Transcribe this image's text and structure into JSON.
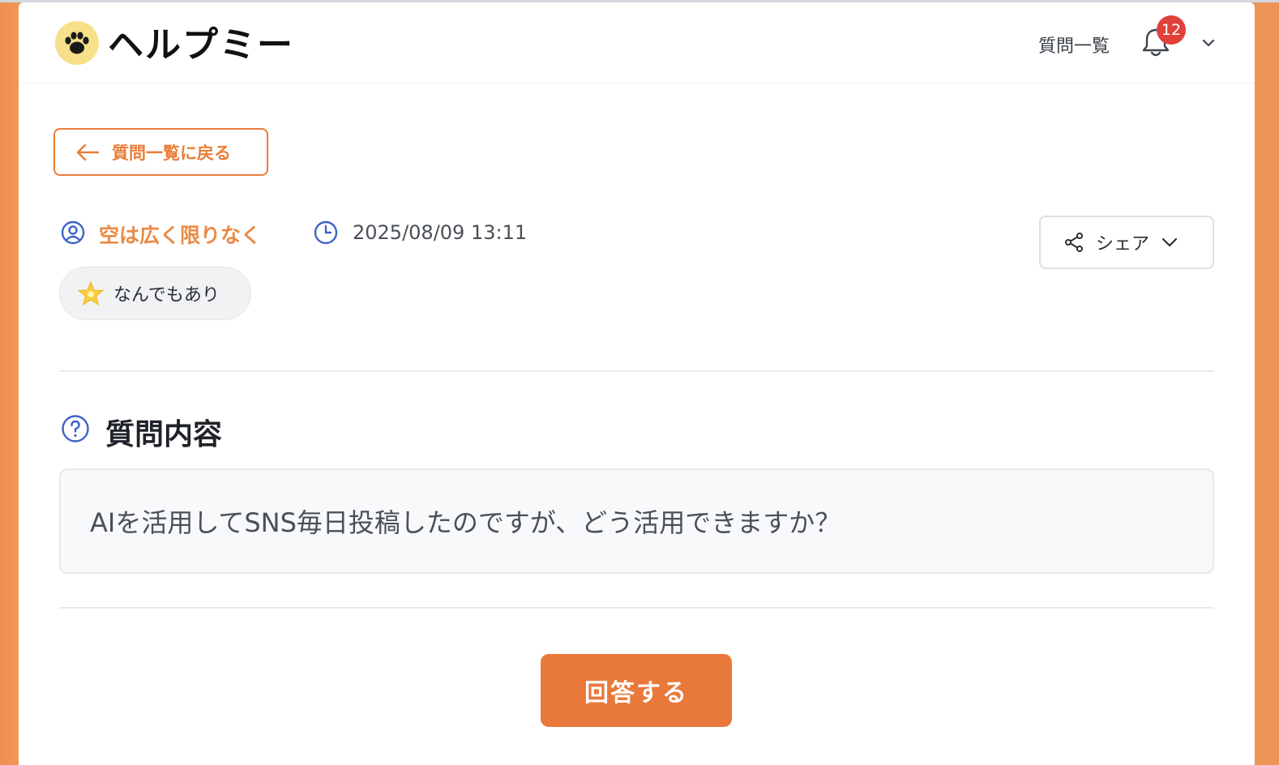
{
  "header": {
    "logo_text": "ヘルプミー",
    "nav_questions": "質問一覧",
    "notification_count": "12"
  },
  "back_button": {
    "label": "質問一覧に戻る"
  },
  "question_meta": {
    "author": "空は広く限りなく",
    "datetime": "2025/08/09 13:11"
  },
  "share": {
    "label": "シェア"
  },
  "tag": {
    "label": "なんでもあり"
  },
  "question_section": {
    "title": "質問内容",
    "body": "AIを活用してSNS毎日投稿したのですが、どう活用できますか？"
  },
  "answer_button": {
    "label": "回答する"
  },
  "colors": {
    "accent": "#e8793a",
    "accent_text": "#ea8a45",
    "icon_blue": "#3d63c9",
    "badge_red": "#e0413a",
    "frame": "#ee9457"
  }
}
